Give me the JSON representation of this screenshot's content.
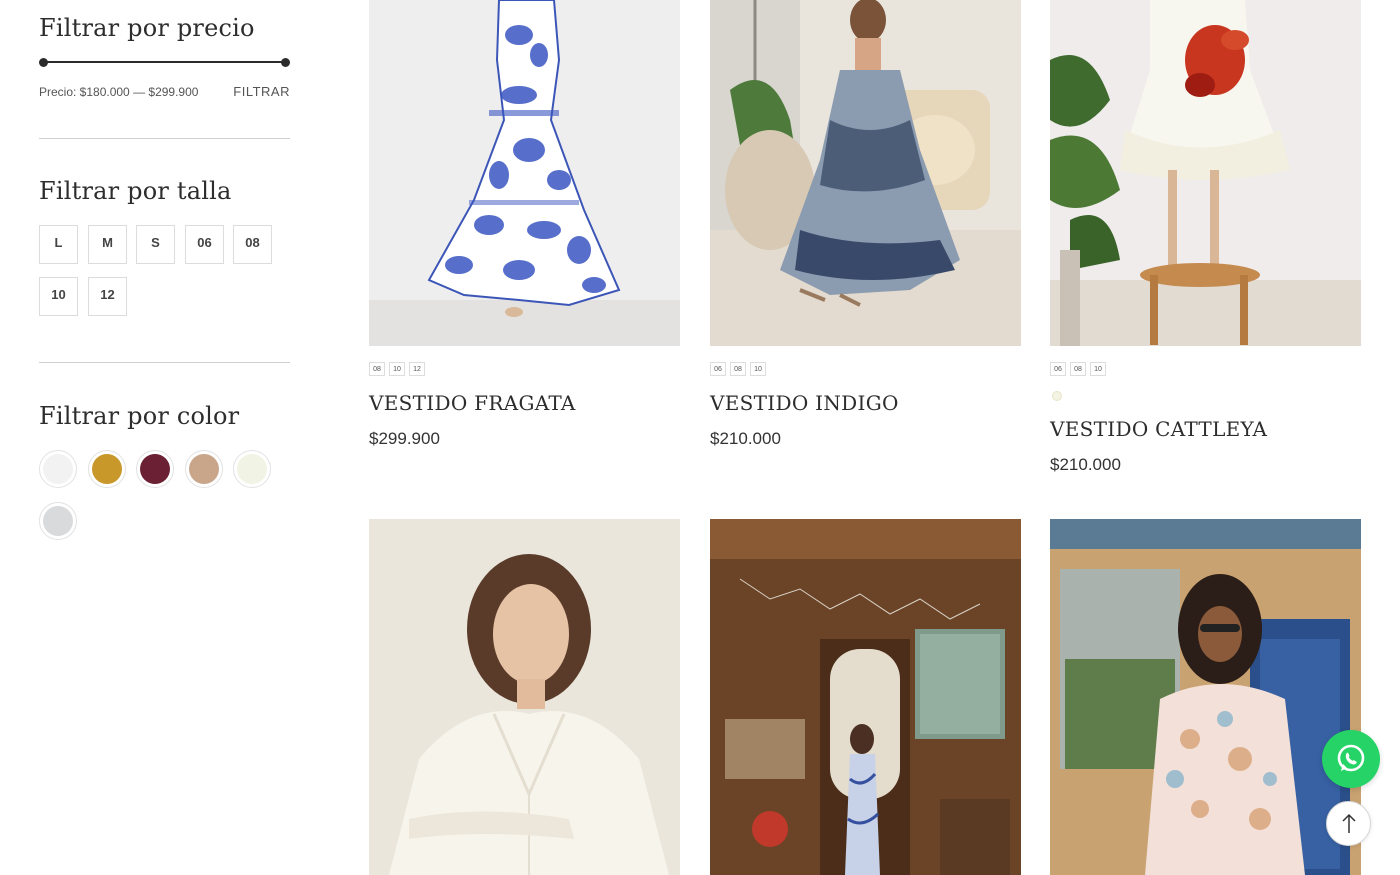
{
  "sidebar": {
    "price_filter": {
      "title": "Filtrar por precio",
      "price_label": "Precio: $180.000 — $299.900",
      "button_label": "FILTRAR",
      "range_min": 180000,
      "range_max": 299900
    },
    "size_filter": {
      "title": "Filtrar por talla",
      "sizes": [
        "L",
        "M",
        "S",
        "06",
        "08",
        "10",
        "12"
      ]
    },
    "color_filter": {
      "title": "Filtrar por color",
      "colors": [
        "#f2f2f2",
        "#c9982a",
        "#6b2034",
        "#c9a58a",
        "#f1f3e4",
        "#d9dadc"
      ]
    }
  },
  "products": [
    {
      "name": "VESTIDO FRAGATA",
      "price": "$299.900",
      "sizes": [
        "08",
        "10",
        "12"
      ]
    },
    {
      "name": "VESTIDO INDIGO",
      "price": "$210.000",
      "sizes": [
        "06",
        "08",
        "10"
      ]
    },
    {
      "name": "VESTIDO CATTLEYA",
      "price": "$210.000",
      "sizes": [
        "06",
        "08",
        "10"
      ],
      "swatch": "#f4f4e2"
    },
    {
      "name": "",
      "price": ""
    },
    {
      "name": "",
      "price": ""
    },
    {
      "name": "",
      "price": ""
    }
  ],
  "floating": {
    "whatsapp_icon": "whatsapp-icon",
    "scroll_top_icon": "arrow-up-icon"
  },
  "colors": {
    "whatsapp": "#25d366",
    "text": "#2d2d2d"
  }
}
